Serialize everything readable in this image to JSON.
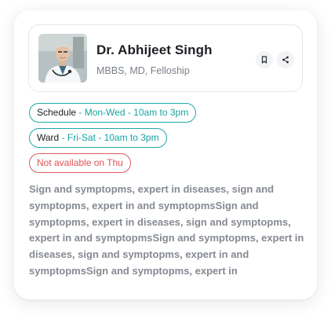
{
  "doctor": {
    "name": "Dr. Abhijeet Singh",
    "degrees": "MBBS, MD, Felloship",
    "avatar": "doctor-portrait"
  },
  "actions": {
    "bookmark_icon": "bookmark-icon",
    "share_icon": "share-icon"
  },
  "tags": {
    "schedule": {
      "label": "Schedule",
      "value": " - Mon-Wed - 10am to 3pm"
    },
    "ward": {
      "label": "Ward",
      "value": " - Fri-Sat - 10am to 3pm"
    },
    "availability": "Not available on Thu"
  },
  "description": "Sign and symptopms, expert in diseases, sign and symptopms, expert in and symptopmsSign and symptopms, expert in diseases, sign and symptopms, expert in and symptopmsSign and symptopms, expert in diseases, sign and symptopms, expert in and symptopmsSign and symptopms, expert in",
  "colors": {
    "accent": "#16a3a2",
    "danger": "#e25454",
    "text_dark": "#1d1f23",
    "text_muted": "#858a92"
  }
}
